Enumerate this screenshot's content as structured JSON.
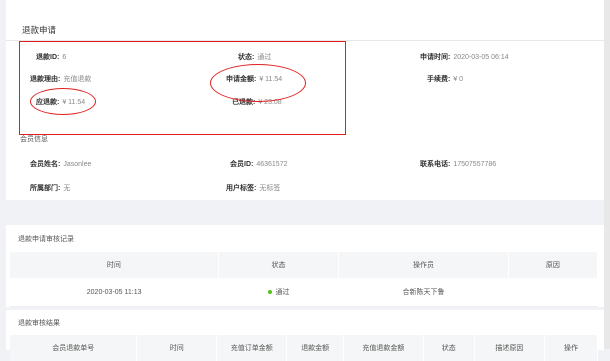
{
  "refund": {
    "title": "退款申请",
    "id_label": "退款ID:",
    "id_value": "6",
    "status_label": "状态:",
    "status_value": "通过",
    "apply_time_label": "申请时间:",
    "apply_time_value": "2020-03-05 06:14",
    "reason_label": "退款理由:",
    "reason_value": "充值退款",
    "apply_amount_label": "申请金额:",
    "apply_amount_value": "¥ 11.54",
    "fee_label": "手续费:",
    "fee_value": "¥ 0",
    "due_label": "应退款:",
    "due_value": "¥ 11.54",
    "refunded_label": "已退款:",
    "refunded_value": "¥ 23.08"
  },
  "member": {
    "title": "会员信息",
    "name_label": "会员姓名:",
    "name_value": "Jasonlee",
    "id_label": "会员ID:",
    "id_value": "46361572",
    "phone_label": "联系电话:",
    "phone_value": "17507557786",
    "dept_label": "所属部门:",
    "dept_value": "无",
    "tag_label": "用户标签:",
    "tag_value": "无标签"
  },
  "review": {
    "title": "退款申请审核记录",
    "headers": [
      "时间",
      "状态",
      "操作员",
      "原因"
    ],
    "row": {
      "time": "2020-03-05 11:13",
      "status": "通过",
      "operator": "合新陈天下鲁",
      "reason": ""
    },
    "status_color": "#52c41a"
  },
  "result": {
    "title": "退款审核结果",
    "headers": [
      "会员退款单号",
      "时间",
      "充值订单金额",
      "退款金额",
      "充值退款金额",
      "状态",
      "描述原因",
      "操作"
    ]
  },
  "colors": {
    "highlight": "#e02020"
  }
}
